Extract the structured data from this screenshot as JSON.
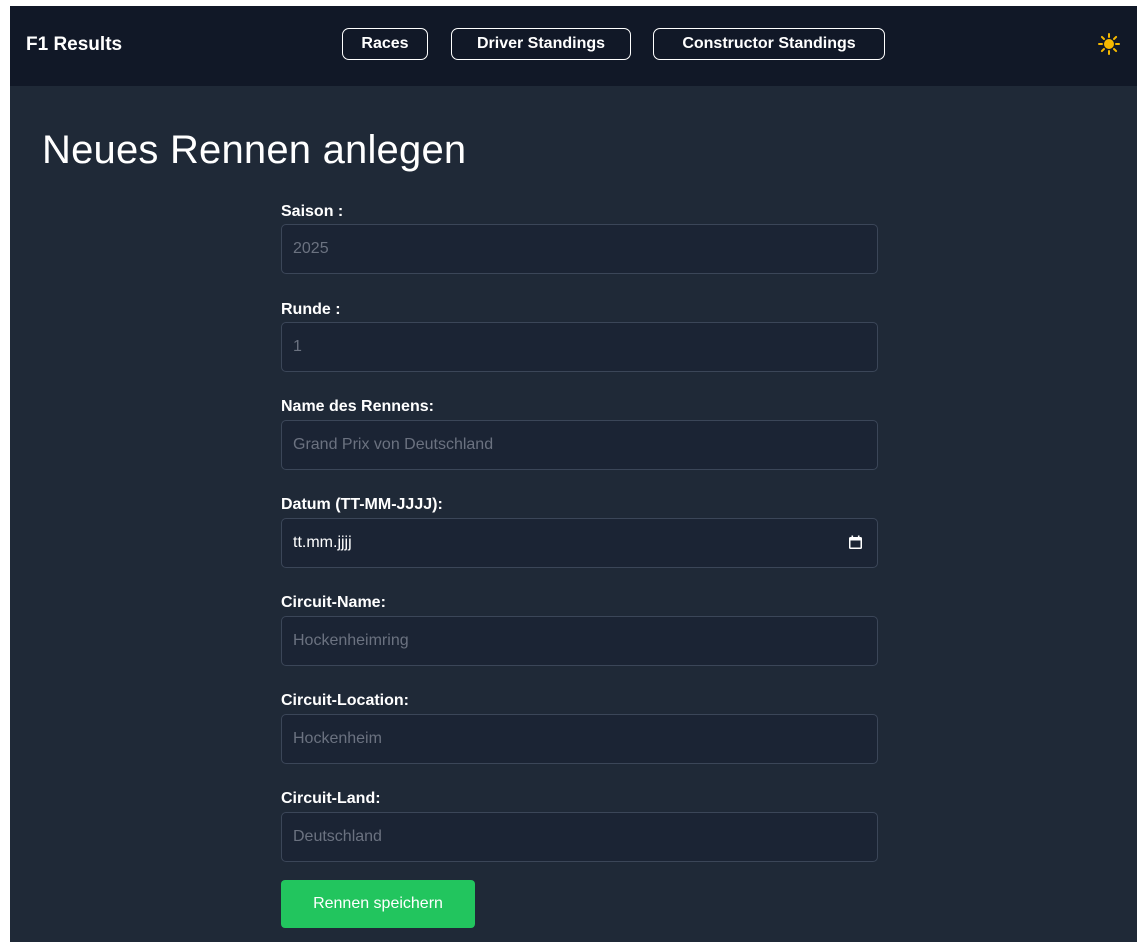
{
  "navbar": {
    "brand": "F1 Results",
    "links": [
      "Races",
      "Driver Standings",
      "Constructor Standings"
    ],
    "theme_icon": "sun-icon"
  },
  "page": {
    "title": "Neues Rennen anlegen"
  },
  "form": {
    "season": {
      "label": "Saison :",
      "placeholder": "2025"
    },
    "round": {
      "label": "Runde :",
      "placeholder": "1"
    },
    "race_name": {
      "label": "Name des Rennens:",
      "placeholder": "Grand Prix von Deutschland"
    },
    "date": {
      "label": "Datum (TT-MM-JJJJ):",
      "value": "tt.mm.jjjj",
      "icon": "calendar-icon"
    },
    "circuit_name": {
      "label": "Circuit-Name:",
      "placeholder": "Hockenheimring"
    },
    "circuit_location": {
      "label": "Circuit-Location:",
      "placeholder": "Hockenheim"
    },
    "circuit_country": {
      "label": "Circuit-Land:",
      "placeholder": "Deutschland"
    },
    "submit_label": "Rennen speichern"
  },
  "colors": {
    "navbar_bg": "#111827",
    "page_bg": "#1f2937",
    "input_bg": "#1b2434",
    "input_border": "#3b4658",
    "placeholder": "#6b7280",
    "submit": "#22c55e",
    "sun": "#f5b800"
  }
}
